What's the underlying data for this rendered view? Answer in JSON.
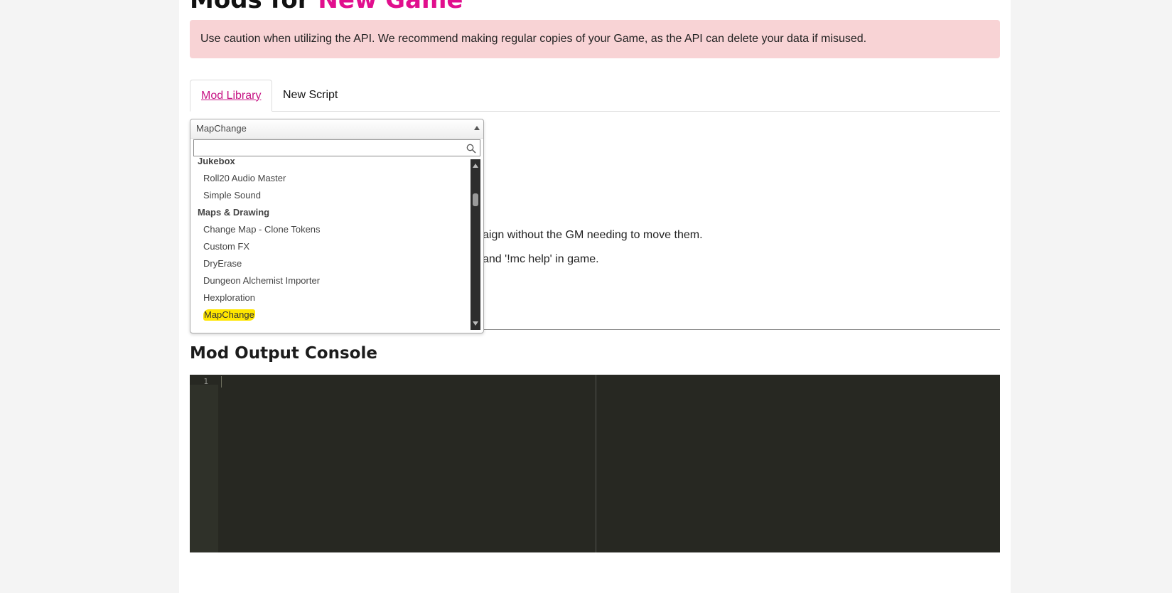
{
  "page": {
    "title_prefix": "Mods for ",
    "title_game": "New Game",
    "accent_color": "#e10f8d"
  },
  "alert": {
    "text": "Use caution when utilizing the API. We recommend making regular copies of your Game, as the API can delete your data if misused."
  },
  "tabs": [
    {
      "label": "Mod Library",
      "active": true
    },
    {
      "label": "New Script",
      "active": false
    }
  ],
  "description": {
    "line1_visible": "aign without the GM needing to move them.",
    "line2_visible": "and '!mc help' in game."
  },
  "dropdown": {
    "selected": "MapChange",
    "search_value": "",
    "groups": [
      {
        "label": "Jukebox",
        "items": [
          "Roll20 Audio Master",
          "Simple Sound"
        ]
      },
      {
        "label": "Maps & Drawing",
        "items": [
          "Change Map - Clone Tokens",
          "Custom FX",
          "DryErase",
          "Dungeon Alchemist Importer",
          "Hexploration",
          "MapChange"
        ]
      }
    ],
    "highlighted": "MapChange",
    "icons": {
      "search": "search-icon",
      "arrow": "chevron-up-icon"
    }
  },
  "console": {
    "title": "Mod Output Console",
    "line_number": "1",
    "background_color": "#272822"
  }
}
